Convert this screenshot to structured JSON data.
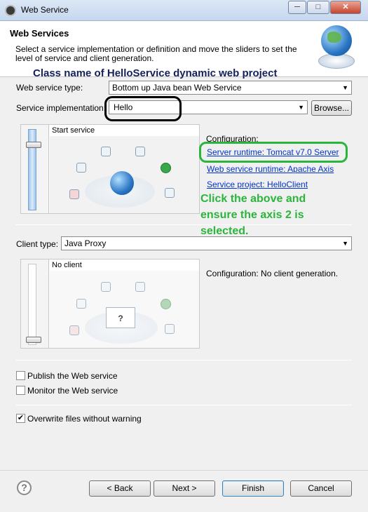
{
  "window": {
    "title": "Web Service",
    "minimize": "─",
    "maximize": "□",
    "close": "✕",
    "icon": "eclipse-icon"
  },
  "header": {
    "title": "Web Services",
    "description": "Select a service implementation or definition and move the sliders to set the level of service and client generation."
  },
  "annotations": {
    "top_note": "Class name of HelloService dynamic web project",
    "side_note": "Click the above and ensure the axis 2 is selected."
  },
  "service": {
    "type_label": "Web service type:",
    "type_value": "Bottom up Java bean Web Service",
    "impl_label": "Service implementation:",
    "impl_value": "Hello",
    "browse_label": "Browse...",
    "scene_label": "Start service",
    "config_label": "Configuration:",
    "links": [
      "Server runtime: Tomcat v7.0 Server",
      "Web service runtime: Apache Axis",
      "Service project: HelloClient"
    ]
  },
  "client": {
    "type_label": "Client type:",
    "type_value": "Java Proxy",
    "scene_label": "No client",
    "config_text": "Configuration: No client generation."
  },
  "options": [
    {
      "label": "Publish the Web service",
      "checked": false
    },
    {
      "label": "Monitor the Web service",
      "checked": false
    },
    {
      "label": "Overwrite files without warning",
      "checked": true
    }
  ],
  "buttons": {
    "back": "< Back",
    "next": "Next >",
    "finish": "Finish",
    "cancel": "Cancel",
    "help": "?"
  },
  "colors": {
    "annotation_green": "#2bb53c",
    "link_blue": "#0033cc",
    "annotation_navy": "#14205a"
  }
}
